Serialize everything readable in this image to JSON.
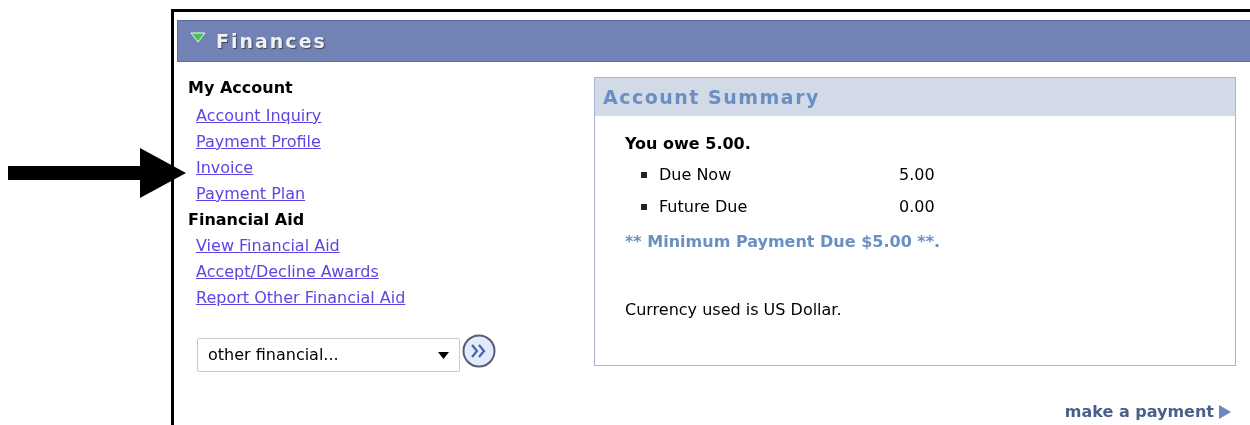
{
  "panel": {
    "title": "Finances",
    "expanded": true
  },
  "sections": [
    {
      "heading": "My Account",
      "links": [
        "Account Inquiry",
        "Payment Profile",
        "Invoice",
        "Payment Plan"
      ]
    },
    {
      "heading": "Financial Aid",
      "links": [
        "View Financial Aid",
        "Accept/Decline Awards",
        "Report Other Financial Aid"
      ]
    }
  ],
  "dropdown": {
    "value": "other financial..."
  },
  "summary": {
    "title": "Account Summary",
    "owe": "You owe 5.00.",
    "items": [
      {
        "label": "Due Now",
        "amount": "5.00"
      },
      {
        "label": "Future Due",
        "amount": "0.00"
      }
    ],
    "minimum": "** Minimum Payment Due $5.00 **.",
    "currency": "Currency used is US Dollar."
  },
  "payment_link": "make a payment"
}
